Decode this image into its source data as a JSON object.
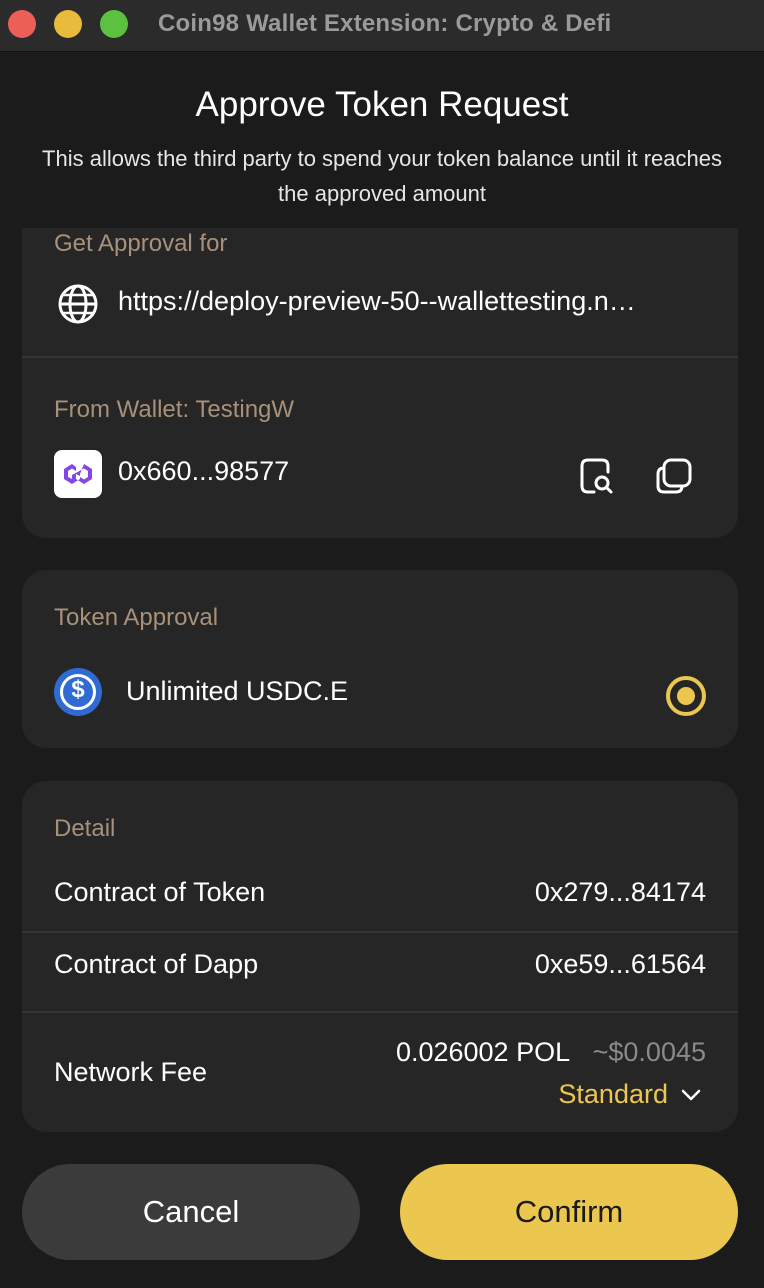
{
  "window": {
    "title": "Coin98 Wallet Extension: Crypto & Defi"
  },
  "header": {
    "title": "Approve Token Request",
    "subtitle": "This allows the third party to spend your token balance until it reaches the approved amount"
  },
  "approval": {
    "label": "Get Approval for",
    "url": "https://deploy-preview-50--wallettesting.n…",
    "icon": "globe-icon"
  },
  "wallet": {
    "label": "From Wallet: TestingW",
    "address": "0x660...98577",
    "chain_icon": "polygon-logo",
    "actions": [
      "explorer-search-icon",
      "copy-icon"
    ]
  },
  "token_approval": {
    "label": "Token Approval",
    "token": "Unlimited USDC.E",
    "token_icon": "usdc-logo",
    "selected": true
  },
  "detail": {
    "label": "Detail",
    "rows": [
      {
        "name": "Contract of Token",
        "value": "0x279...84174"
      },
      {
        "name": "Contract of Dapp",
        "value": "0xe59...61564"
      }
    ],
    "fee": {
      "name": "Network Fee",
      "amount": "0.026002 POL",
      "usd": "~$0.0045",
      "speed": "Standard"
    }
  },
  "buttons": {
    "cancel": "Cancel",
    "confirm": "Confirm"
  },
  "colors": {
    "accent": "#ecc74f",
    "card": "#262626",
    "background": "#1b1b1b",
    "label": "#a8917a"
  }
}
